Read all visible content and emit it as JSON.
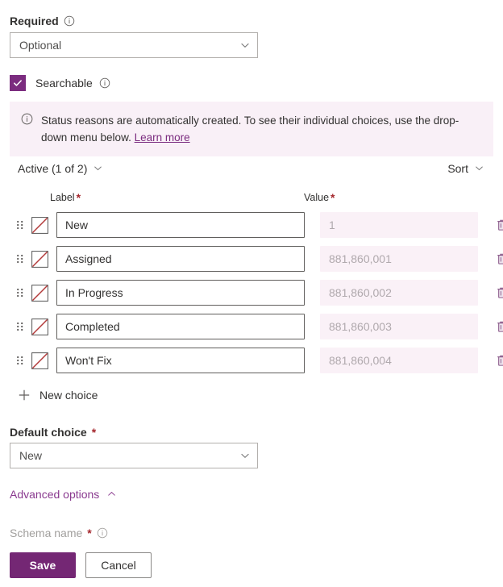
{
  "theme": {
    "accent": "#742774",
    "accent_light": "#8a3a8f",
    "banner_bg": "#f9f0f7",
    "disabled_field_bg": "#faf1f7",
    "required_star": "#a4262c"
  },
  "required_field": {
    "label": "Required",
    "info_icon": "info-circle-icon",
    "value": "Optional",
    "chevron": "chevron-down-icon"
  },
  "searchable": {
    "label": "Searchable",
    "checked": true,
    "check_icon": "checkmark-icon",
    "info_icon": "info-circle-icon"
  },
  "banner": {
    "icon": "info-circle-icon",
    "text": "Status reasons are automatically created. To see their individual choices, use the drop-down menu below.",
    "link_text": "Learn more"
  },
  "choices_toolbar": {
    "state_label": "Active (1 of 2)",
    "state_chevron": "chevron-down-icon",
    "sort_label": "Sort",
    "sort_chevron": "chevron-down-icon"
  },
  "choices_table": {
    "columns": {
      "label": "Label",
      "label_required": "*",
      "value": "Value",
      "value_required": "*"
    },
    "grip_icon": "drag-handle-icon",
    "color_icon": "no-color-swatch-icon",
    "delete_icon": "trash-icon",
    "rows": [
      {
        "label": "New",
        "value": "1"
      },
      {
        "label": "Assigned",
        "value": "881,860,001"
      },
      {
        "label": "In Progress",
        "value": "881,860,002"
      },
      {
        "label": "Completed",
        "value": "881,860,003"
      },
      {
        "label": "Won't Fix",
        "value": "881,860,004"
      }
    ]
  },
  "new_choice": {
    "label": "New choice",
    "icon": "plus-icon"
  },
  "default_choice": {
    "label": "Default choice",
    "required_star": "*",
    "value": "New",
    "chevron": "chevron-down-icon"
  },
  "advanced_options": {
    "label": "Advanced options",
    "chevron": "chevron-up-icon",
    "expanded": true
  },
  "schema_name": {
    "label": "Schema name",
    "required_star": "*",
    "info_icon": "info-circle-icon",
    "disabled": true
  },
  "actions": {
    "save_label": "Save",
    "cancel_label": "Cancel"
  }
}
